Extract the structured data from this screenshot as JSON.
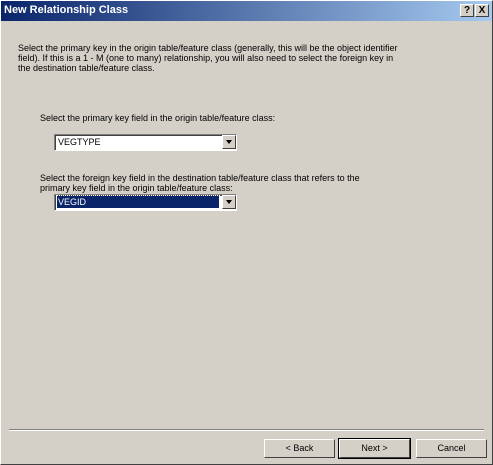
{
  "window": {
    "title": "New Relationship Class",
    "help_label": "?",
    "close_label": "X"
  },
  "content": {
    "description": "Select the primary key in the origin table/feature class (generally, this will be the object identifier field). If this is a 1 - M (one to many) relationship, you will also need to select the foreign key in the destination table/feature class.",
    "primary_key_label": "Select the primary key field in the origin table/feature class:",
    "primary_key_value": "VEGTYPE",
    "foreign_key_label": "Select the foreign key field in the destination table/feature class that refers to the primary key field in the origin table/feature class:",
    "foreign_key_value": "VEGID"
  },
  "buttons": {
    "back": "< Back",
    "next": "Next >",
    "cancel": "Cancel"
  },
  "colors": {
    "titlebar_start": "#0a246a",
    "titlebar_end": "#a6caf0",
    "dialog_bg": "#d4d0c8",
    "selection": "#0a246a"
  }
}
